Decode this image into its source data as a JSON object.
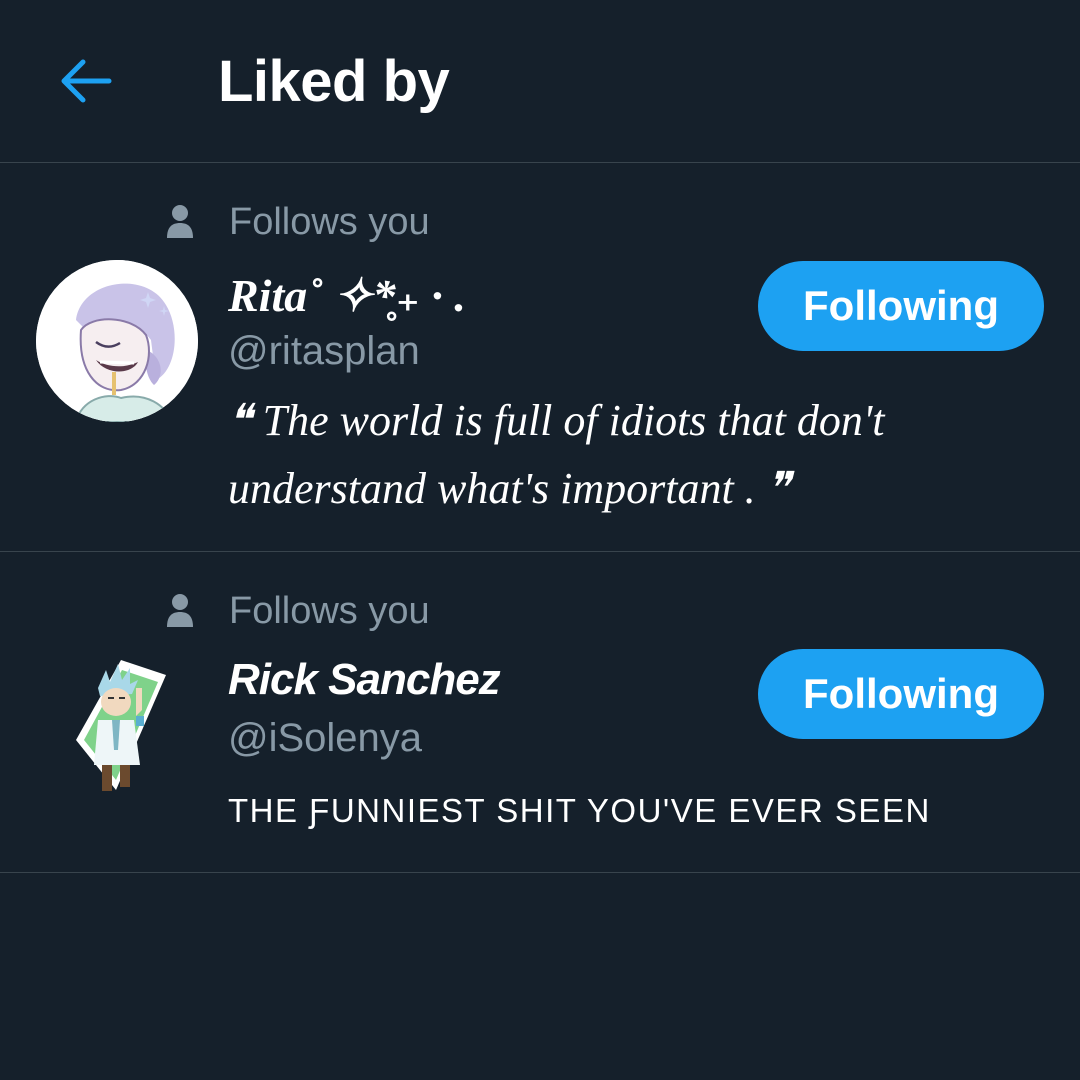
{
  "header": {
    "back_icon": "arrow-left-icon",
    "title": "Liked by"
  },
  "colors": {
    "background": "#15202b",
    "accent": "#1da1f2",
    "secondary_text": "#8899a6",
    "divider": "#38444d"
  },
  "users": [
    {
      "follows_label": "Follows you",
      "display_name": "Rita˚ ✧*̥₊ · .",
      "handle": "@ritasplan",
      "button_label": "Following",
      "bio": "❝ The world is full of idiots that don't understand what's important . ❞"
    },
    {
      "follows_label": "Follows you",
      "display_name": "Rick Sanchez",
      "handle": "@iSolenya",
      "button_label": "Following",
      "bio": "THE ƑUNNIEST SHIT YOU'VE EVER SEEN"
    }
  ]
}
